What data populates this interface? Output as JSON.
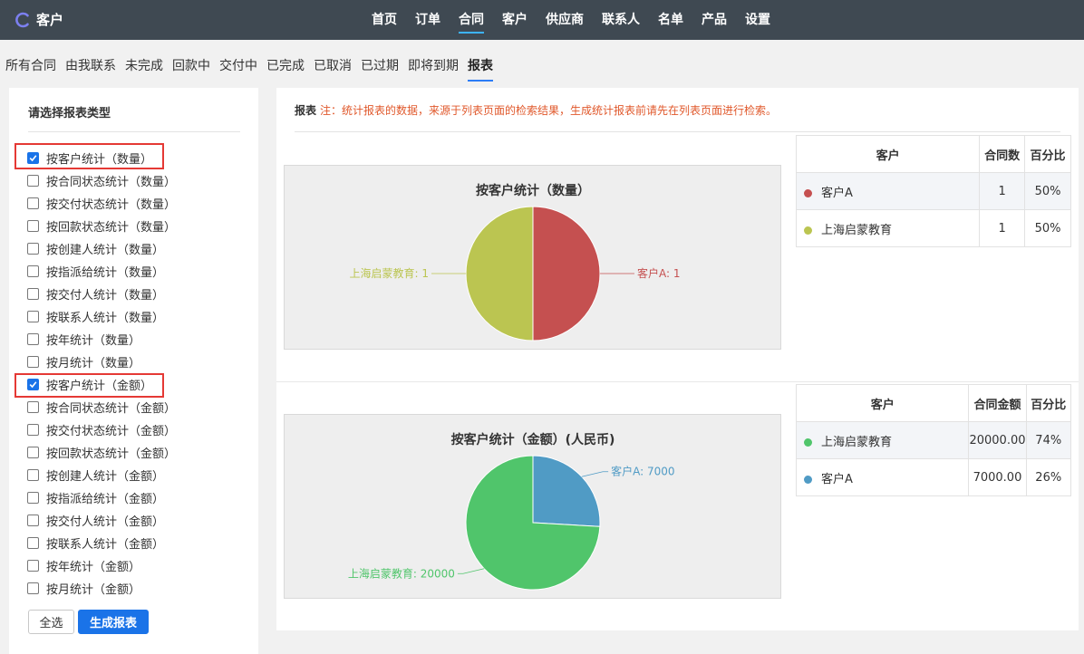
{
  "app": {
    "name": "客户",
    "logo_icon": "c-logo-icon",
    "brand_color": "#7c80f0"
  },
  "nav": {
    "items": [
      {
        "label": "首页",
        "active": false
      },
      {
        "label": "订单",
        "active": false
      },
      {
        "label": "合同",
        "active": true
      },
      {
        "label": "客户",
        "active": false
      },
      {
        "label": "供应商",
        "active": false
      },
      {
        "label": "联系人",
        "active": false
      },
      {
        "label": "名单",
        "active": false
      },
      {
        "label": "产品",
        "active": false
      },
      {
        "label": "设置",
        "active": false
      }
    ]
  },
  "subnav": {
    "items": [
      {
        "label": "所有合同",
        "active": false
      },
      {
        "label": "由我联系",
        "active": false
      },
      {
        "label": "未完成",
        "active": false
      },
      {
        "label": "回款中",
        "active": false
      },
      {
        "label": "交付中",
        "active": false
      },
      {
        "label": "已完成",
        "active": false
      },
      {
        "label": "已取消",
        "active": false
      },
      {
        "label": "已过期",
        "active": false
      },
      {
        "label": "即将到期",
        "active": false
      },
      {
        "label": "报表",
        "active": true
      }
    ]
  },
  "left": {
    "title": "请选择报表类型",
    "options": [
      {
        "label": "按客户统计（数量）",
        "checked": true
      },
      {
        "label": "按合同状态统计（数量）",
        "checked": false
      },
      {
        "label": "按交付状态统计（数量）",
        "checked": false
      },
      {
        "label": "按回款状态统计（数量）",
        "checked": false
      },
      {
        "label": "按创建人统计（数量）",
        "checked": false
      },
      {
        "label": "按指派给统计（数量）",
        "checked": false
      },
      {
        "label": "按交付人统计（数量）",
        "checked": false
      },
      {
        "label": "按联系人统计（数量）",
        "checked": false
      },
      {
        "label": "按年统计（数量）",
        "checked": false
      },
      {
        "label": "按月统计（数量）",
        "checked": false
      },
      {
        "label": "按客户统计（金额）",
        "checked": true
      },
      {
        "label": "按合同状态统计（金额）",
        "checked": false
      },
      {
        "label": "按交付状态统计（金额）",
        "checked": false
      },
      {
        "label": "按回款状态统计（金额）",
        "checked": false
      },
      {
        "label": "按创建人统计（金额）",
        "checked": false
      },
      {
        "label": "按指派给统计（金额）",
        "checked": false
      },
      {
        "label": "按交付人统计（金额）",
        "checked": false
      },
      {
        "label": "按联系人统计（金额）",
        "checked": false
      },
      {
        "label": "按年统计（金额）",
        "checked": false
      },
      {
        "label": "按月统计（金额）",
        "checked": false
      }
    ],
    "select_all_label": "全选",
    "generate_label": "生成报表"
  },
  "report": {
    "title": "报表",
    "note": "注：统计报表的数据，来源于列表页面的检索结果，生成统计报表前请先在列表页面进行检索。",
    "table1": {
      "headers": [
        "客户",
        "合同数",
        "百分比"
      ],
      "rows": [
        {
          "name": "客户A",
          "value": "1",
          "pct": "50%",
          "color": "#c55050"
        },
        {
          "name": "上海启蒙教育",
          "value": "1",
          "pct": "50%",
          "color": "#bbc551"
        }
      ]
    },
    "table2": {
      "headers": [
        "客户",
        "合同金额",
        "百分比"
      ],
      "rows": [
        {
          "name": "上海启蒙教育",
          "value": "20000.00",
          "pct": "74%",
          "color": "#50c56b"
        },
        {
          "name": "客户A",
          "value": "7000.00",
          "pct": "26%",
          "color": "#509bc5"
        }
      ]
    }
  },
  "chart_data": [
    {
      "type": "pie",
      "title": "按客户统计（数量）",
      "slices": [
        {
          "label": "客户A",
          "value": 1,
          "color": "#c55050",
          "data_label": "客户A: 1"
        },
        {
          "label": "上海启蒙教育",
          "value": 1,
          "color": "#bbc551",
          "data_label": "上海启蒙教育: 1"
        }
      ]
    },
    {
      "type": "pie",
      "title": "按客户统计（金额）(人民币)",
      "slices": [
        {
          "label": "客户A",
          "value": 7000,
          "color": "#509bc5",
          "data_label": "客户A: 7000"
        },
        {
          "label": "上海启蒙教育",
          "value": 20000,
          "color": "#50c56b",
          "data_label": "上海启蒙教育: 20000"
        }
      ]
    }
  ]
}
